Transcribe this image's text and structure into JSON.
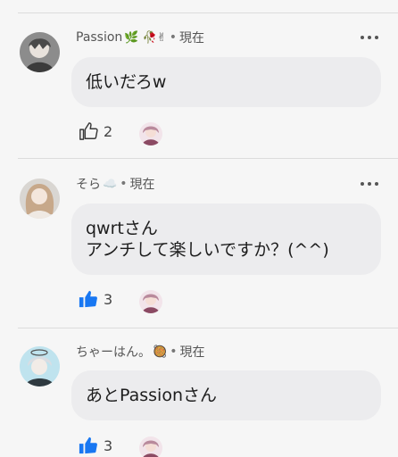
{
  "comments": [
    {
      "author": "Passion",
      "author_emoji": "🌿 🥀✌",
      "time": "現在",
      "lines": [
        "低いだろw"
      ],
      "likes": "2",
      "liked": false
    },
    {
      "author": "そら",
      "author_emoji": "☁️",
      "time": "現在",
      "lines": [
        "qwrtさん",
        "アンチして楽しいですか？(^^)"
      ],
      "likes": "3",
      "liked": true
    },
    {
      "author": "ちゃーはん。",
      "author_emoji": "🥘",
      "time": "現在",
      "lines": [
        "あとPassionさん"
      ],
      "likes": "3",
      "liked": true
    }
  ],
  "separator": "•",
  "colors": {
    "like_active": "#1877f2",
    "like_inactive": "#3a3a3a",
    "bubble": "#ececee",
    "background": "#f6f6f6"
  }
}
